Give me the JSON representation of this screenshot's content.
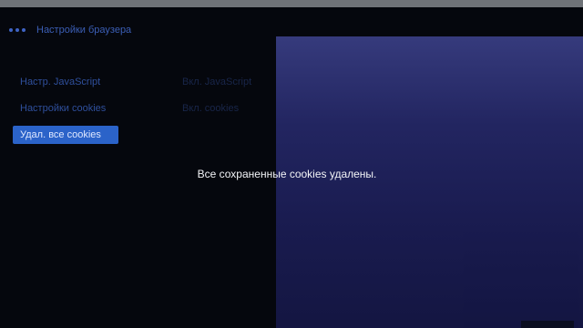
{
  "header": {
    "title": "Настройки браузера"
  },
  "settings": {
    "rows": [
      {
        "label": "Настр. JavaScript",
        "value": "Вкл. JavaScript"
      },
      {
        "label": "Настройки cookies",
        "value": "Вкл. cookies"
      },
      {
        "label": "Удал. все cookies"
      }
    ]
  },
  "panel": {
    "rows": [
      {
        "c1": "",
        "c2": ""
      },
      {
        "c1": "",
        "c2": ""
      },
      {
        "c1": "",
        "c2": ""
      },
      {
        "c1": "",
        "c2": ""
      },
      {
        "c1": "",
        "c2": ""
      },
      {
        "c1": "",
        "c2": ""
      },
      {
        "c1": "",
        "c2": ""
      },
      {
        "c1": "",
        "c2": ""
      },
      {
        "c1": "",
        "c2": ""
      },
      {
        "c1": "",
        "c2": ""
      },
      {
        "c1": "",
        "c2": ""
      },
      {
        "c1": "",
        "c2": ""
      }
    ]
  },
  "toast": {
    "message": "Все сохраненные cookies удалены."
  },
  "colors": {
    "accent": "#2b63c9",
    "background": "#05070d",
    "panel": "#252868"
  }
}
